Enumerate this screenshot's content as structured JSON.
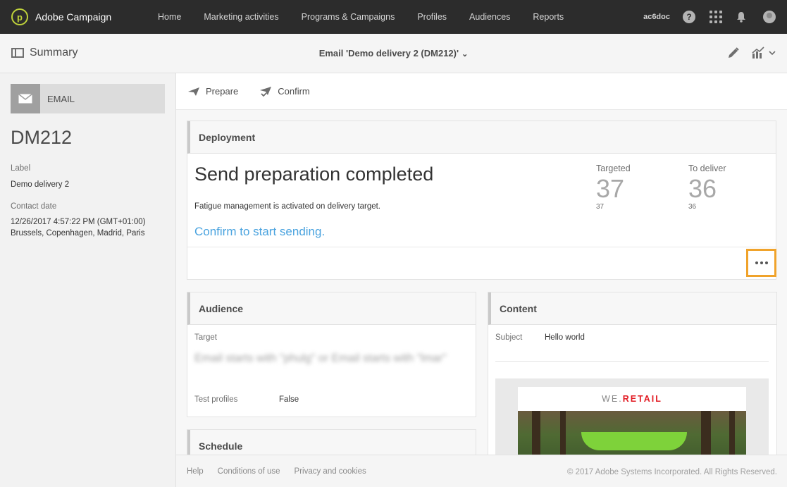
{
  "app": {
    "name": "Adobe Campaign",
    "user_code": "ac6doc"
  },
  "nav": {
    "items": [
      "Home",
      "Marketing activities",
      "Programs & Campaigns",
      "Profiles",
      "Audiences",
      "Reports"
    ]
  },
  "header": {
    "summary_label": "Summary",
    "delivery_title": "Email 'Demo delivery 2 (DM212)'"
  },
  "left": {
    "channel": "EMAIL",
    "code": "DM212",
    "label_caption": "Label",
    "label_value": "Demo delivery 2",
    "contact_caption": "Contact date",
    "contact_date": "12/26/2017 4:57:22 PM (GMT+01:00)",
    "contact_tz": "Brussels, Copenhagen, Madrid, Paris"
  },
  "toolbar": {
    "prepare": "Prepare",
    "confirm": "Confirm"
  },
  "deployment": {
    "title": "Deployment",
    "status": "Send preparation completed",
    "note": "Fatigue management is activated on delivery target.",
    "link": "Confirm to start sending.",
    "targeted_label": "Targeted",
    "targeted_value": "37",
    "targeted_sub": "37",
    "deliver_label": "To deliver",
    "deliver_value": "36",
    "deliver_sub": "36"
  },
  "audience": {
    "title": "Audience",
    "target_label": "Target",
    "target_value": "Email starts with \"phulg\" or Email starts with \"lmar\"",
    "test_label": "Test profiles",
    "test_value": "False"
  },
  "content": {
    "title": "Content",
    "subject_label": "Subject",
    "subject_value": "Hello world",
    "brand_prefix": "WE.",
    "brand_accent": "RETAIL"
  },
  "schedule": {
    "title": "Schedule"
  },
  "footer": {
    "links": [
      "Help",
      "Conditions of use",
      "Privacy and cookies"
    ],
    "copyright": "© 2017 Adobe Systems Incorporated. All Rights Reserved."
  },
  "colors": {
    "accent_link": "#4aa3df",
    "highlight": "#f0a32b",
    "brand_logo": "#bfd23a",
    "retail_red": "#e21b23"
  }
}
